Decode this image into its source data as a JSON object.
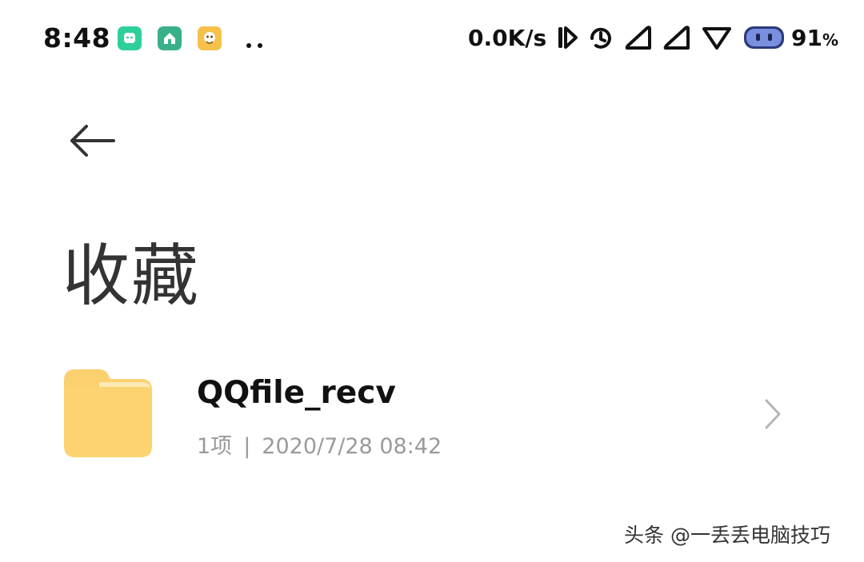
{
  "status_bar": {
    "time": "8:48",
    "notification_icons": [
      "chat-app-icon",
      "home-app-icon",
      "game-app-icon"
    ],
    "network_speed": "0.0K/s",
    "battery_percent": "91",
    "battery_unit": "%",
    "accent_colors": {
      "chat": "#2ecf9a",
      "home": "#3ab08a",
      "game": "#f6c14b"
    }
  },
  "page": {
    "title": "收藏"
  },
  "items": [
    {
      "name": "QQfile_recv",
      "count": "1项",
      "separator": "|",
      "date": "2020/7/28 08:42",
      "icon": "folder-icon",
      "folder_color": "#fcd06f"
    }
  ],
  "watermark": "头条 @一丢丢电脑技巧"
}
